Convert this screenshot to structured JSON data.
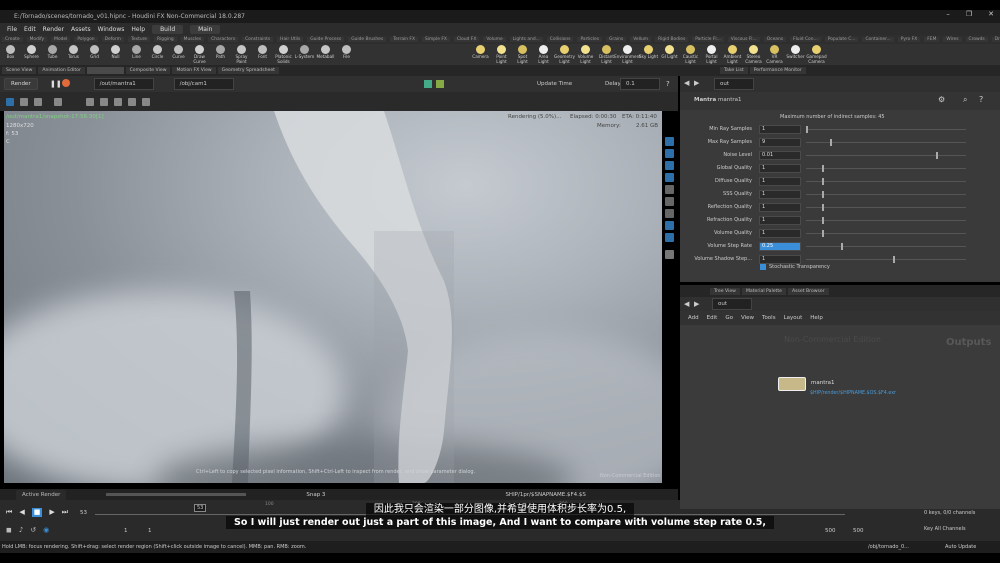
{
  "window": {
    "title": "E:/Tornado/scenes/tornado_v01.hipnc - Houdini FX Non-Commercial 18.0.287",
    "controls": [
      "–",
      "❐",
      "✕"
    ]
  },
  "menubar": {
    "items": [
      "File",
      "Edit",
      "Render",
      "Assets",
      "Windows",
      "Help"
    ],
    "build": "Build",
    "main": "Main"
  },
  "shelf_tabs": [
    "Create",
    "Modify",
    "Model",
    "Polygon",
    "Deform",
    "Texture",
    "Rigging",
    "Muscles",
    "Characters",
    "Constraints",
    "Hair Utils",
    "Guide Process",
    "Guide Brushes",
    "Terrain FX",
    "Simple FX",
    "Cloud FX",
    "Volume",
    "Lights and...",
    "Collisions",
    "Particles",
    "Grains",
    "Vellum",
    "Rigid Bodies",
    "Particle Fl...",
    "Viscous Fl...",
    "Oceans",
    "Fluid Con...",
    "Populate C...",
    "Container...",
    "Pyro FX",
    "FEM",
    "Wires",
    "Crowds",
    "Drive Sim..."
  ],
  "create_tools": [
    "Box",
    "Sphere",
    "Tube",
    "Torus",
    "Grid",
    "Null",
    "Line",
    "Circle",
    "Curve",
    "Draw Curve",
    "Path",
    "Spray Paint",
    "Font",
    "Platonic Solids",
    "L-System",
    "Metaball",
    "File"
  ],
  "light_tools": [
    "Camera",
    "Point Light",
    "Spot Light",
    "Area Light",
    "Geometry Light",
    "Volume Light",
    "Distant Light",
    "Environment Light",
    "Sky Light",
    "GI Light",
    "Caustic Light",
    "Portal Light",
    "Ambient Light",
    "Stereo Camera",
    "VR Camera",
    "Switcher",
    "Gamepad Camera"
  ],
  "left_panel_tabs": [
    "Scene View",
    "Animation Editor",
    "Render View",
    "Composite View",
    "Motion FX View",
    "Geometry Spreadsheet"
  ],
  "render_view": {
    "render_button": "Render",
    "rop": "/out/mantra1",
    "camera": "/obj/cam1",
    "update_mode": "Update Time",
    "delay_label": "Delay",
    "delay_value": "0.1",
    "snapshot": "/out/mantra1/snapshot-17:56:30[1]",
    "resolution": "1280x720",
    "frame": "f: 53",
    "extra": "C",
    "status": "Rendering (5.0%)...",
    "elapsed": "Elapsed: 0:00:30",
    "eta": "ETA: 0:11:40",
    "memory_label": "Memory:",
    "memory": "2.61 GB",
    "hint": "Ctrl+Left to copy selected pixel information, Shift+Ctrl-Left to inspect from render, and show parameter dialog.",
    "watermark": "Non-Commercial Edition"
  },
  "render_bottom": {
    "tab": "Active Render",
    "snap": "Snap 3",
    "path": "SHIP/1pr/$SNAPNAME.$F4.$S"
  },
  "playbar": {
    "frame": "53",
    "start": "1",
    "start2": "1",
    "end": "500",
    "end2": "500",
    "current_marker": "53",
    "ticks": [
      "100",
      "200",
      "300",
      "400",
      "500"
    ],
    "keys": "0 keys, 0/0 channels",
    "key_all": "Key All Channels",
    "auto_update": "Auto Update",
    "obj_path": "/obj/tornado_0..."
  },
  "status_line": "Hold LMB: focus rendering. Shift+drag: select render region (Shift+click outside image to cancel). MMB: pan. RMB: zoom.",
  "param_pane": {
    "tabs": [
      "Take List",
      "Performance Monitor"
    ],
    "path": "out",
    "node_type": "Mantra",
    "node_name": "mantra1",
    "header_note": "Maximum number of indirect samples: 45",
    "params": [
      {
        "label": "Min Ray Samples",
        "value": "1",
        "slider": 0.0
      },
      {
        "label": "Max Ray Samples",
        "value": "9",
        "slider": 0.15
      },
      {
        "label": "Noise Level",
        "value": "0.01",
        "slider": 0.82
      },
      {
        "label": "Global Quality",
        "value": "1",
        "slider": 0.1
      },
      {
        "label": "Diffuse Quality",
        "value": "1",
        "slider": 0.1
      },
      {
        "label": "SSS Quality",
        "value": "1",
        "slider": 0.1
      },
      {
        "label": "Reflection Quality",
        "value": "1",
        "slider": 0.1
      },
      {
        "label": "Refraction Quality",
        "value": "1",
        "slider": 0.1
      },
      {
        "label": "Volume Quality",
        "value": "1",
        "slider": 0.1
      },
      {
        "label": "Volume Step Rate",
        "value": "0.25",
        "slider": 0.22
      },
      {
        "label": "Volume Shadow Step...",
        "value": "1",
        "slider": 0.55
      }
    ],
    "stochastic": "Stochastic Transparency"
  },
  "network_pane": {
    "tabs": [
      "Tree View",
      "Material Palette",
      "Asset Browser"
    ],
    "path": "out",
    "menu": [
      "Add",
      "Edit",
      "Go",
      "View",
      "Tools",
      "Layout",
      "Help"
    ],
    "watermark": "Non-Commercial Edition",
    "context": "Outputs",
    "node_name": "mantra1",
    "node_output": "$HIP/render/$HIPNAME.$OS.$F4.exr"
  },
  "subtitles": {
    "zh": "因此我只会渲染一部分图像,并希望使用体积步长率为0.5,",
    "en": "So I will just render out just a part of this image, And I want to compare with volume step rate 0.5,"
  },
  "colors": {
    "accent": "#2d6fa8",
    "highlight": "#3a8fd8",
    "render_text": "#7fd27f"
  }
}
